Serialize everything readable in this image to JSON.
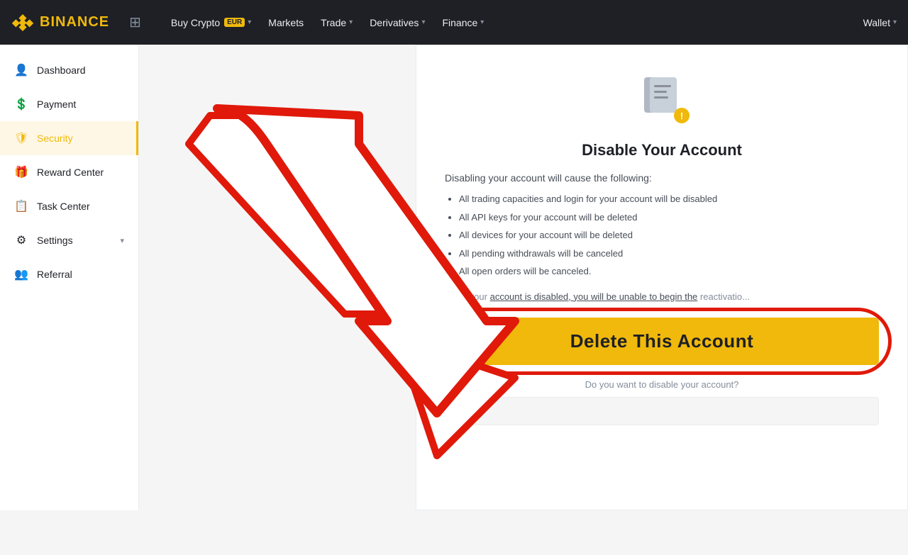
{
  "header": {
    "logo_text": "BINANCE",
    "grid_label": "Apps",
    "nav": [
      {
        "label": "Buy Crypto",
        "badge": "EUR",
        "has_dropdown": true
      },
      {
        "label": "Markets",
        "has_dropdown": false
      },
      {
        "label": "Trade",
        "has_dropdown": true
      },
      {
        "label": "Derivatives",
        "has_dropdown": true
      },
      {
        "label": "Finance",
        "has_dropdown": true
      }
    ],
    "wallet_label": "Wallet"
  },
  "sidebar": {
    "items": [
      {
        "id": "dashboard",
        "label": "Dashboard",
        "icon": "👤"
      },
      {
        "id": "payment",
        "label": "Payment",
        "icon": "💲"
      },
      {
        "id": "security",
        "label": "Security",
        "icon": "🛡",
        "active": true
      },
      {
        "id": "reward-center",
        "label": "Reward Center",
        "icon": "🎁"
      },
      {
        "id": "task-center",
        "label": "Task Center",
        "icon": "📋"
      },
      {
        "id": "settings",
        "label": "Settings",
        "icon": "⚙",
        "has_chevron": true
      },
      {
        "id": "referral",
        "label": "Referral",
        "icon": "👥"
      }
    ]
  },
  "card": {
    "title": "Disable Your Account",
    "subtitle": "Disabling your account will cause the following:",
    "bullets": [
      "All trading capacities and login for your account will be disabled",
      "All API keys for your account will be deleted",
      "All devices for your account will be deleted",
      "All pending withdrawals will be canceled",
      "All open orders will be canceled."
    ],
    "note": "Once your account is disabled, you will be unable to begin the reactivatio...",
    "delete_button_label": "Delete This Account",
    "question": "Do you want to disable your account?",
    "input_placeholder": ""
  }
}
